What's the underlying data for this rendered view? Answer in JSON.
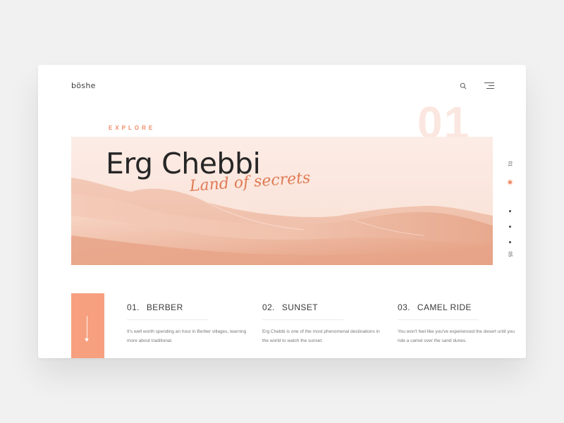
{
  "brand": {
    "logo": "böshe"
  },
  "header": {
    "search_icon": "search-icon",
    "menu_icon": "menu-icon"
  },
  "hero": {
    "eyebrow": "EXPLORE",
    "big_number": "01",
    "title": "Erg Chebbi",
    "tagline": "Land of secrets"
  },
  "pager": {
    "start": "01",
    "end": "05",
    "total_dots": 4,
    "active_index": 0
  },
  "features": [
    {
      "number": "01.",
      "title": "BERBER",
      "description": "It's well worth spending an hour in Berber villages, learning more about traditional."
    },
    {
      "number": "02.",
      "title": "SUNSET",
      "description": "Erg Chebbi is one of the most phenomenal destinations in the world to watch the sunset."
    },
    {
      "number": "03.",
      "title": "CAMEL RIDE",
      "description": "You won't feel like you've experienced the desert until you ride a camel over the sand dunes."
    }
  ],
  "colors": {
    "accent": "#f08a66",
    "block": "#f6a07f",
    "ghost_number": "#fbe7e0",
    "text": "#262626"
  }
}
